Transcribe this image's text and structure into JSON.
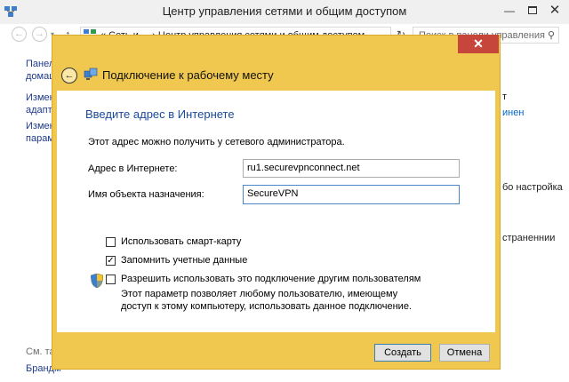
{
  "background_window": {
    "title": "Центр управления сетями и общим доступом",
    "address_path": "«  Сеть и ...  ›  Центр управления сетями и общим доступом",
    "search_placeholder": "Поиск в панели управления",
    "left_pane": {
      "item1_line1": "Панель",
      "item1_line2": "домаш",
      "item2_line1": "Измене",
      "item2_line2": "адаптер",
      "item3_line1": "Измене",
      "item3_line2": "парамет",
      "see_also": "См. так",
      "firewall": "Брандм"
    },
    "right_fragments": {
      "frag1": "т",
      "frag2": "инен",
      "frag3": "бо настройка",
      "frag4": "страненнии"
    }
  },
  "dialog": {
    "title": "Подключение к рабочему месту",
    "heading": "Введите адрес в Интернете",
    "admin_note": "Этот адрес можно получить у сетевого администратора.",
    "address_label": "Адрес в Интернете:",
    "address_value": "ru1.securevpnconnect.net",
    "destination_label": "Имя объекта назначения:",
    "destination_value": "SecureVPN",
    "smartcard_label": "Использовать смарт-карту",
    "smartcard_checked": false,
    "remember_label": "Запомнить учетные данные",
    "remember_checked": true,
    "share_label": "Разрешить использовать это подключение другим пользователям",
    "share_checked": false,
    "share_desc": "Этот параметр позволяет любому пользователю, имеющему доступ к этому компьютеру, использовать данное подключение.",
    "create_button": "Создать",
    "cancel_button": "Отмена"
  },
  "icons": {
    "check_glyph": "✓",
    "close_glyph": "✕",
    "minimize_glyph": "—",
    "back_glyph": "←",
    "forward_glyph": "→",
    "up_glyph": "↑",
    "refresh_glyph": "↻",
    "history_glyph": "▾",
    "search_glyph": "⚲"
  },
  "colors": {
    "dialog_frame": "#f0c84f",
    "close_button": "#c7463c",
    "heading_blue": "#1a4a9a",
    "focus_border": "#4a86c8"
  }
}
